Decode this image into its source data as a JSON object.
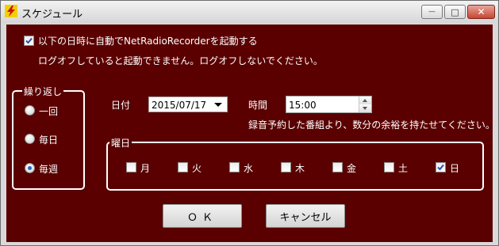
{
  "window": {
    "title": "スケジュール",
    "min_glyph": "—",
    "max_glyph": "□",
    "close_glyph": "✕"
  },
  "auto_start": {
    "checked": true,
    "label": "以下の日時に自動でNetRadioRecorderを起動する",
    "note": "ログオフしていると起動できません。ログオフしないでください。"
  },
  "repeat": {
    "legend": "繰り返し",
    "options": [
      {
        "label": "一回",
        "selected": false
      },
      {
        "label": "毎日",
        "selected": false
      },
      {
        "label": "毎週",
        "selected": true
      }
    ]
  },
  "date": {
    "label": "日付",
    "value": "2015/07/17"
  },
  "time": {
    "label": "時間",
    "value": "15:00",
    "note": "録音予約した番組より、数分の余裕を持たせてください。"
  },
  "weekday": {
    "legend": "曜日",
    "days": [
      {
        "label": "月",
        "checked": false
      },
      {
        "label": "火",
        "checked": false
      },
      {
        "label": "水",
        "checked": false
      },
      {
        "label": "木",
        "checked": false
      },
      {
        "label": "金",
        "checked": false
      },
      {
        "label": "土",
        "checked": false
      },
      {
        "label": "日",
        "checked": true
      }
    ]
  },
  "buttons": {
    "ok": "ＯＫ",
    "cancel": "キャンセル"
  },
  "colors": {
    "background": "#5a0000",
    "accent_check": "#2b4fa8"
  }
}
